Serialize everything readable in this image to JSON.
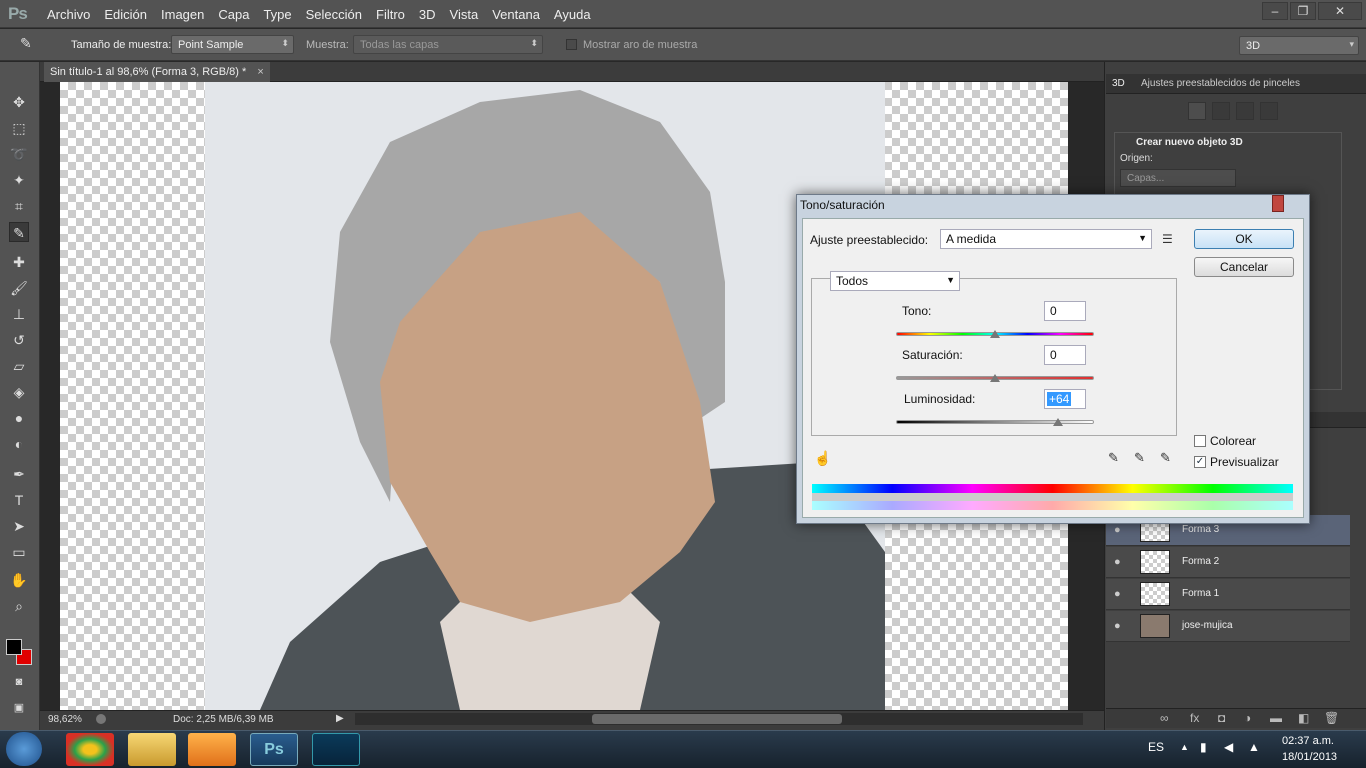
{
  "app": {
    "logo": "Ps"
  },
  "menu": [
    "Archivo",
    "Edición",
    "Imagen",
    "Capa",
    "Type",
    "Selección",
    "Filtro",
    "3D",
    "Vista",
    "Ventana",
    "Ayuda"
  ],
  "window_controls": {
    "minimize": "–",
    "restore": "❐",
    "close": "✕"
  },
  "options": {
    "sample_size_label": "Tamaño de muestra:",
    "sample_size_value": "Point Sample",
    "sample_label": "Muestra:",
    "sample_value": "Todas las capas",
    "show_ring_label": "Mostrar aro de muestra",
    "workspace": "3D"
  },
  "document": {
    "tab_title": "Sin título-1 al 98,6% (Forma 3, RGB/8) *",
    "close": "×"
  },
  "status": {
    "zoom": "98,62%",
    "doc": "Doc: 2,25 MB/6,39 MB"
  },
  "panel": {
    "tabs": [
      "3D",
      "Ajustes preestablecidos de pinceles"
    ],
    "create_label": "Crear nuevo objeto 3D",
    "origin_label": "Origen:",
    "origin_value": "Capas..."
  },
  "layers": [
    {
      "name": "Forma 3"
    },
    {
      "name": "Forma 2"
    },
    {
      "name": "Forma 1"
    },
    {
      "name": "jose-mujica"
    }
  ],
  "dialog": {
    "title": "Tono/saturación",
    "preset_label": "Ajuste preestablecido:",
    "preset_value": "A medida",
    "channel": "Todos",
    "hue_label": "Tono:",
    "hue_value": "0",
    "saturation_label": "Saturación:",
    "saturation_value": "0",
    "lightness_label": "Luminosidad:",
    "lightness_value": "+64",
    "ok": "OK",
    "cancel": "Cancelar",
    "colorize_label": "Colorear",
    "colorize_checked": false,
    "preview_label": "Previsualizar",
    "preview_checked": true,
    "hue_pos": 0.5,
    "saturation_pos": 0.5,
    "lightness_pos": 0.82
  },
  "taskbar": {
    "lang": "ES",
    "time": "02:37 a.m.",
    "date": "18/01/2013"
  }
}
